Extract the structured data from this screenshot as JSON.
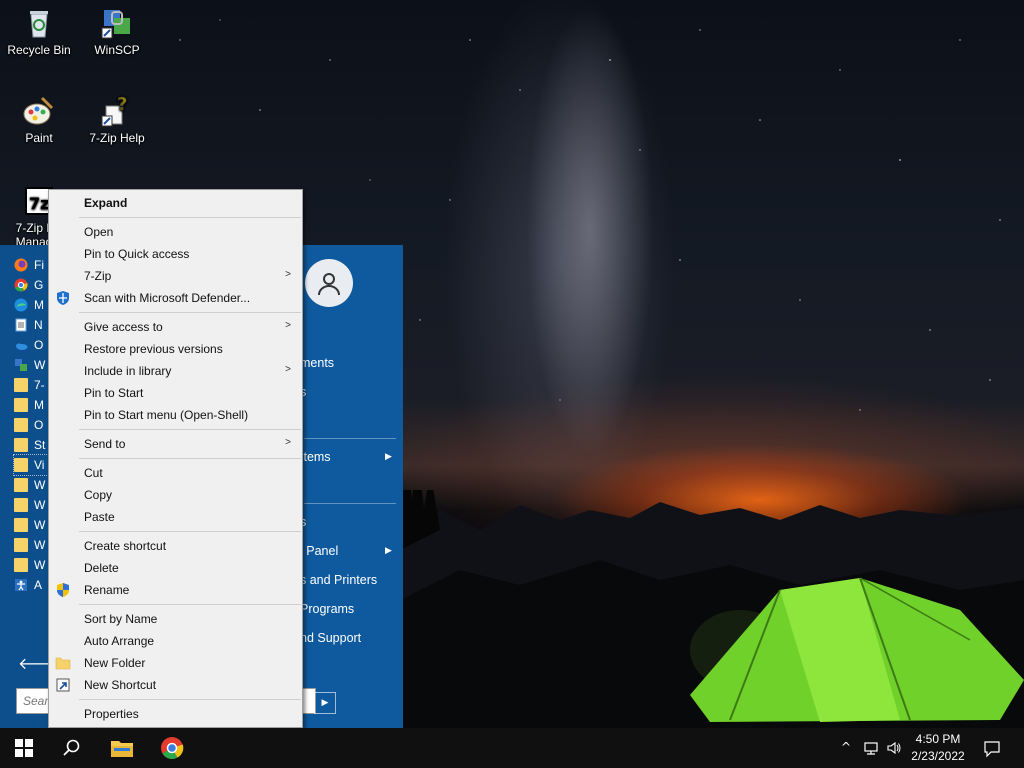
{
  "desktop": {
    "icons": [
      {
        "label": "Recycle Bin",
        "icon": "recycle-bin-icon"
      },
      {
        "label": "WinSCP",
        "icon": "winscp-icon"
      },
      {
        "label": "Paint",
        "icon": "paint-icon"
      },
      {
        "label": "7-Zip Help",
        "icon": "help-icon"
      },
      {
        "label": "7-Zip F...\nManag...",
        "icon": "seven-zip-icon"
      }
    ]
  },
  "start_menu": {
    "programs": [
      {
        "label": "Fi",
        "icon": "firefox-icon"
      },
      {
        "label": "G",
        "icon": "chrome-icon"
      },
      {
        "label": "M",
        "icon": "edge-icon"
      },
      {
        "label": "N",
        "icon": "notepad-icon"
      },
      {
        "label": "O",
        "icon": "onedrive-icon"
      },
      {
        "label": "W",
        "icon": "winscp-icon"
      },
      {
        "label": "7-",
        "icon": "folder-icon"
      },
      {
        "label": "M",
        "icon": "folder-icon"
      },
      {
        "label": "O",
        "icon": "folder-icon"
      },
      {
        "label": "St",
        "icon": "folder-icon"
      },
      {
        "label": "Vi",
        "icon": "folder-icon"
      },
      {
        "label": "W",
        "icon": "folder-icon"
      },
      {
        "label": "W",
        "icon": "folder-icon"
      },
      {
        "label": "W",
        "icon": "folder-icon"
      },
      {
        "label": "W",
        "icon": "folder-icon"
      },
      {
        "label": "W",
        "icon": "folder-icon"
      },
      {
        "label": "A",
        "icon": "accessibility-icon"
      }
    ],
    "right_items": [
      {
        "label": "ments"
      },
      {
        "label": "s"
      },
      {
        "label": "Items"
      },
      {
        "label": "s"
      },
      {
        "label": "l Panel"
      },
      {
        "label": "s and Printers"
      },
      {
        "label": "Programs"
      },
      {
        "label": "nd Support"
      }
    ],
    "search_placeholder": "Sear"
  },
  "context_menu": {
    "items": [
      {
        "label": "Expand"
      },
      {
        "label": "Open"
      },
      {
        "label": "Pin to Quick access"
      },
      {
        "label": "7-Zip"
      },
      {
        "label": "Scan with Microsoft Defender..."
      },
      {
        "label": "Give access to"
      },
      {
        "label": "Restore previous versions"
      },
      {
        "label": "Include in library"
      },
      {
        "label": "Pin to Start"
      },
      {
        "label": "Pin to Start menu (Open-Shell)"
      },
      {
        "label": "Send to"
      },
      {
        "label": "Cut"
      },
      {
        "label": "Copy"
      },
      {
        "label": "Paste"
      },
      {
        "label": "Create shortcut"
      },
      {
        "label": "Delete"
      },
      {
        "label": "Rename"
      },
      {
        "label": "Sort by Name"
      },
      {
        "label": "Auto Arrange"
      },
      {
        "label": "New Folder"
      },
      {
        "label": "New Shortcut"
      },
      {
        "label": "Properties"
      }
    ]
  },
  "taskbar": {
    "time": "4:50 PM",
    "date": "2/23/2022"
  },
  "colors": {
    "start_menu_bg": "#0f5a9e",
    "context_menu_bg": "#f0f0f0",
    "taskbar_bg": "#101010"
  }
}
